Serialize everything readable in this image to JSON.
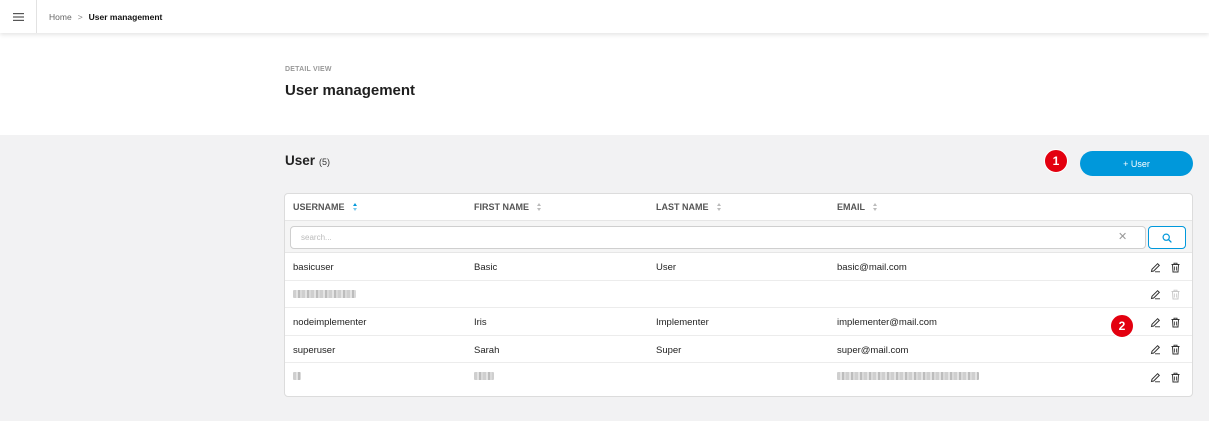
{
  "topbar": {
    "breadcrumb": {
      "home": "Home",
      "separator": ">",
      "current": "User management"
    }
  },
  "header": {
    "detail_label": "DETAIL VIEW",
    "title": "User management"
  },
  "section": {
    "title": "User",
    "count": "(5)"
  },
  "add_button": {
    "label": "+ User"
  },
  "annotations": {
    "badge1": "1",
    "badge2": "2"
  },
  "table": {
    "columns": [
      "USERNAME",
      "FIRST NAME",
      "LAST NAME",
      "EMAIL"
    ],
    "sorted_column": "USERNAME",
    "search": {
      "placeholder": "search...",
      "value": "",
      "clear_icon": "close-icon",
      "search_icon": "search-icon"
    },
    "rows": [
      {
        "username": "basicuser",
        "first_name": "Basic",
        "last_name": "User",
        "email": "basic@mail.com",
        "delete_enabled": true,
        "redacted": false
      },
      {
        "username": "",
        "first_name": "",
        "last_name": "",
        "email": "",
        "delete_enabled": false,
        "redacted": true
      },
      {
        "username": "nodeimplementer",
        "first_name": "Iris",
        "last_name": "Implementer",
        "email": "implementer@mail.com",
        "delete_enabled": true,
        "redacted": false
      },
      {
        "username": "superuser",
        "first_name": "Sarah",
        "last_name": "Super",
        "email": "super@mail.com",
        "delete_enabled": true,
        "redacted": false
      },
      {
        "username": "",
        "first_name": "",
        "last_name": "",
        "email": "",
        "delete_enabled": true,
        "redacted": true
      }
    ]
  },
  "colors": {
    "accent": "#0098db",
    "badge": "#e3000f",
    "content_bg": "#f2f2f3"
  },
  "icons": {
    "menu": "hamburger-menu-icon",
    "edit": "pencil-icon",
    "delete": "trash-icon"
  }
}
